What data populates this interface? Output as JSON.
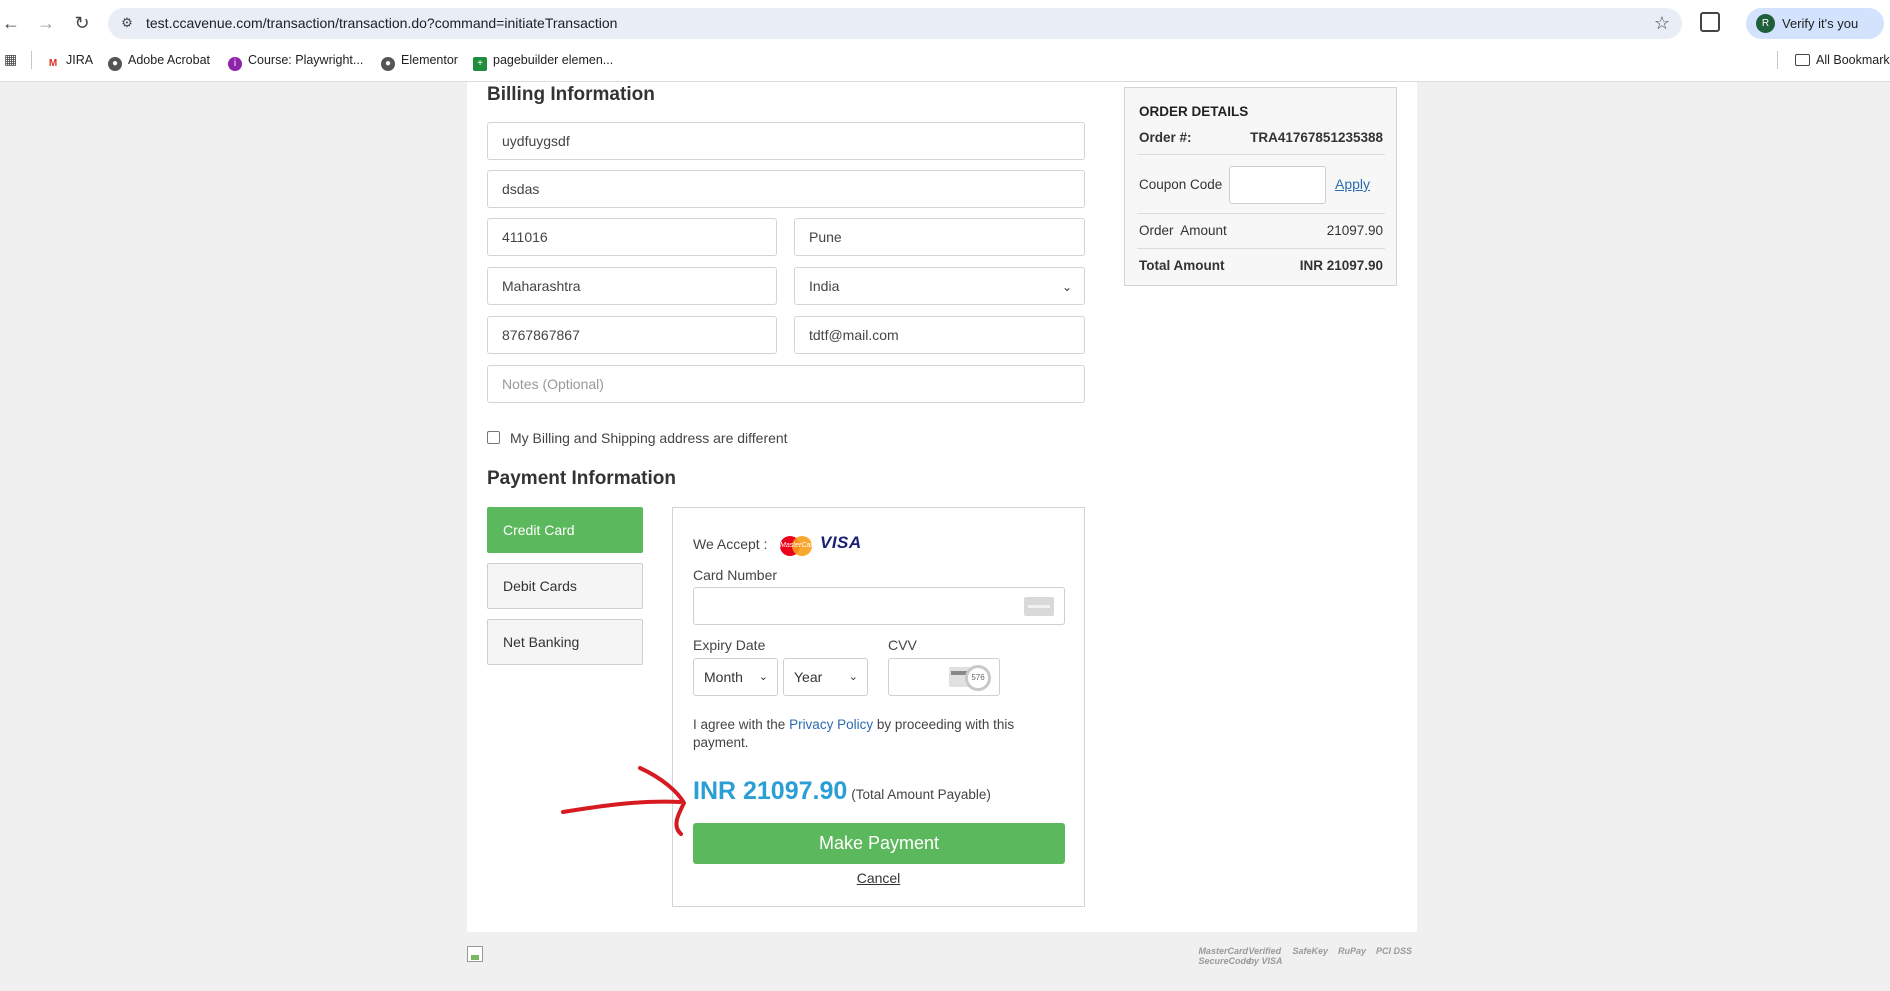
{
  "browser": {
    "url": "test.ccavenue.com/transaction/transaction.do?command=initiateTransaction",
    "profile_initial": "R",
    "profile_label": "Verify it's you",
    "bookmarks": [
      "JIRA",
      "Adobe Acrobat",
      "Course: Playwright...",
      "Elementor",
      "pagebuilder elemen..."
    ],
    "all_bookmarks": "All Bookmark"
  },
  "billing": {
    "title": "Billing Information",
    "name": "uydfuygsdf",
    "address": "dsdas",
    "zip": "411016",
    "city": "Pune",
    "state": "Maharashtra",
    "country": "India",
    "phone": "8767867867",
    "email": "tdtf@mail.com",
    "notes_placeholder": "Notes (Optional)",
    "different_address_label": "My Billing and Shipping address are different"
  },
  "payment": {
    "title": "Payment Information",
    "methods": [
      "Credit Card",
      "Debit Cards",
      "Net Banking"
    ],
    "active_method": "Credit Card",
    "we_accept": "We Accept :",
    "mastercard_text": "MasterCard",
    "visa_text": "VISA",
    "card_number_label": "Card Number",
    "expiry_label": "Expiry Date",
    "month_value": "Month",
    "year_value": "Year",
    "cvv_label": "CVV",
    "cvv_hint": "576",
    "agree_prefix": "I agree with the ",
    "privacy_link": "Privacy Policy",
    "agree_suffix": " by proceeding with this payment.",
    "amount": "INR 21097.90",
    "amount_note": "(Total Amount Payable)",
    "pay_button": "Make Payment",
    "cancel": "Cancel"
  },
  "order": {
    "title": "ORDER DETAILS",
    "order_label": "Order #:",
    "order_id": "TRA41767851235388",
    "coupon_label": "Coupon Code",
    "apply": "Apply",
    "order_amount_label": "Order  Amount",
    "order_amount": "21097.90",
    "total_label": "Total Amount",
    "total_amount": "INR 21097.90"
  },
  "footer": {
    "logos": [
      "MasterCard SecureCode",
      "Verified by VISA",
      "SafeKey",
      "RuPay",
      "PCI DSS"
    ]
  },
  "colors": {
    "green": "#5cb85c",
    "amount_blue": "#2a9fd6",
    "annotation_red": "#d71920"
  }
}
